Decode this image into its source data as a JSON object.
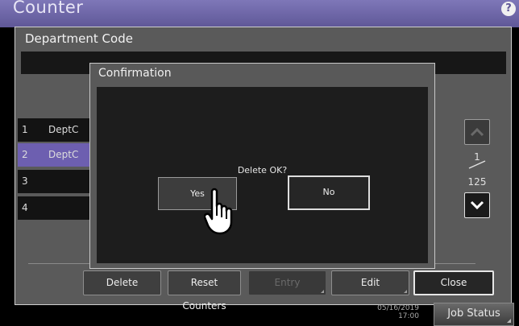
{
  "header": {
    "title": "Counter",
    "help_icon": "?"
  },
  "panel": {
    "title": "Department Code"
  },
  "list": {
    "rows": [
      {
        "num": "1",
        "name": "DeptC",
        "selected": false
      },
      {
        "num": "2",
        "name": "DeptC",
        "selected": true
      },
      {
        "num": "3",
        "name": "",
        "selected": false
      },
      {
        "num": "4",
        "name": "",
        "selected": false
      }
    ]
  },
  "pagination": {
    "current": "1",
    "total": "125"
  },
  "buttons": {
    "delete": "Delete",
    "reset_counters": "Reset Counters",
    "entry": "Entry",
    "edit": "Edit",
    "close": "Close"
  },
  "status": {
    "date": "05/16/2019",
    "time": "17:00",
    "job_status": "Job Status"
  },
  "dialog": {
    "title": "Confirmation",
    "message": "Delete OK?",
    "yes": "Yes",
    "no": "No"
  },
  "colors": {
    "accent": "#6d5fb0",
    "header": "#6f68a8"
  }
}
